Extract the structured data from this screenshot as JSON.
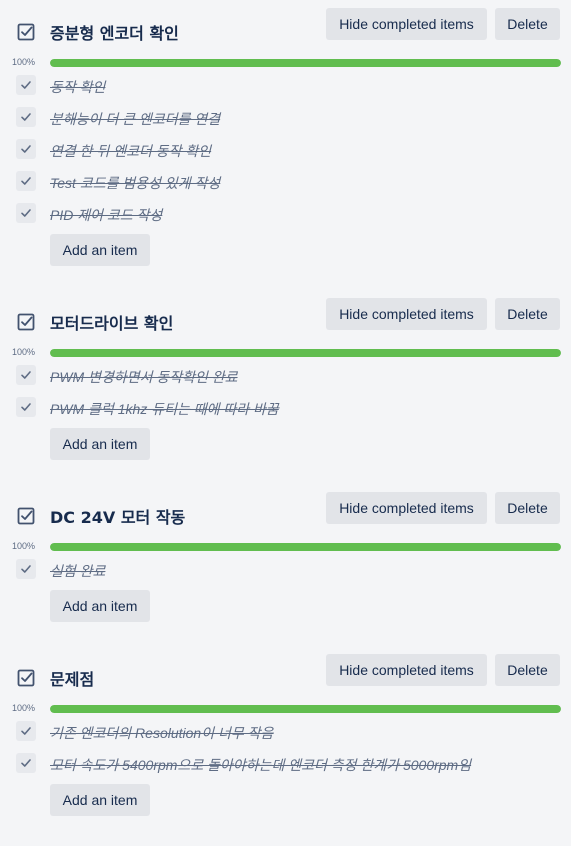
{
  "buttons": {
    "hide_completed": "Hide completed items",
    "delete": "Delete",
    "add_item": "Add an item"
  },
  "colors": {
    "progress": "#61bd4f",
    "button_bg": "#e2e4e8",
    "page_bg": "#f4f5f7"
  },
  "icons": {
    "checklist": "checkbox-checked-icon",
    "item_check": "checkmark-icon"
  },
  "checklists": [
    {
      "title": "증분형 엔코더 확인",
      "progress_label": "100%",
      "progress": 100,
      "items": [
        {
          "text": "동작 확인",
          "done": true
        },
        {
          "text": "분해능이 더 큰 엔코더를 연결",
          "done": true
        },
        {
          "text": "연결 한 뒤 엔코더 동작 확인",
          "done": true
        },
        {
          "text": "Test 코드를 범용성 있게 작성",
          "done": true
        },
        {
          "text": "PID 제어 코드 작성",
          "done": true
        }
      ]
    },
    {
      "title": "모터드라이브 확인",
      "progress_label": "100%",
      "progress": 100,
      "items": [
        {
          "text": "PWM 변경하면서 동작확인 완료",
          "done": true
        },
        {
          "text": "PWM 클럭 1khz 듀티는 때에 따라 바꿈",
          "done": true
        }
      ]
    },
    {
      "title": "DC 24V 모터 작동",
      "progress_label": "100%",
      "progress": 100,
      "items": [
        {
          "text": "실험 완료",
          "done": true
        }
      ]
    },
    {
      "title": "문제점",
      "progress_label": "100%",
      "progress": 100,
      "items": [
        {
          "text": "기존 엔코더의 Resolution이 너무 작음",
          "done": true
        },
        {
          "text": "모터 속도가 5400rpm으로 돌아야하는데 엔코더 측정 한계가 5000rpm임",
          "done": true
        }
      ]
    }
  ]
}
